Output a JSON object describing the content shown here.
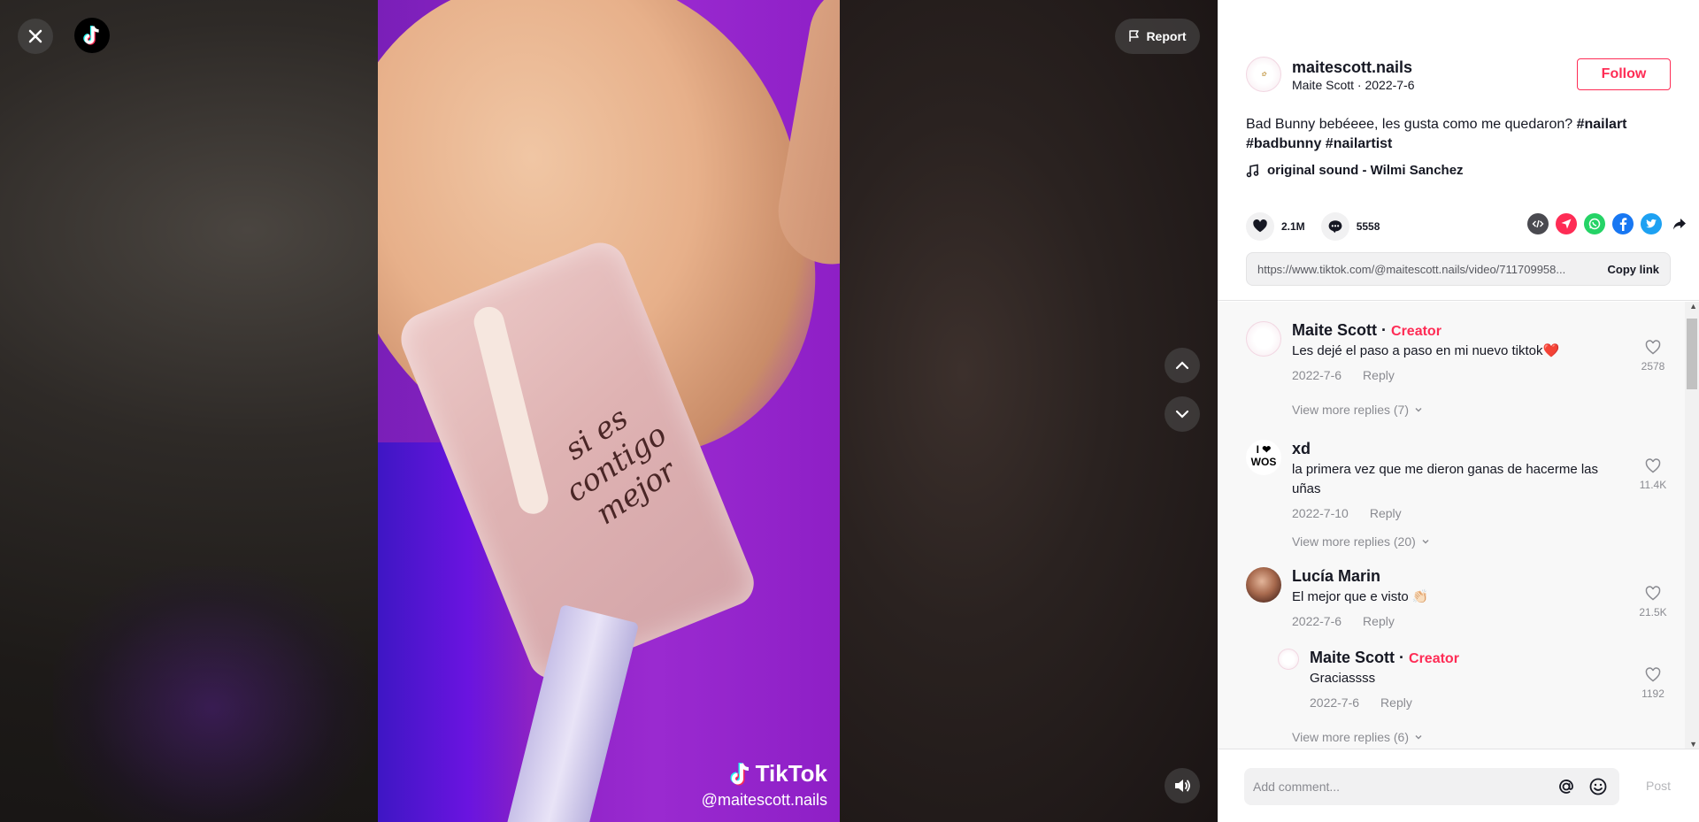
{
  "video": {
    "nail_text": "si es contigo mejor",
    "watermark_logo": "TikTok",
    "watermark_handle": "@maitescott.nails"
  },
  "overlay": {
    "report_label": "Report",
    "icons": [
      "close-icon",
      "tiktok-logo-icon",
      "flag-icon",
      "chevron-up-icon",
      "chevron-down-icon",
      "volume-icon"
    ]
  },
  "author": {
    "username": "maitescott.nails",
    "subtitle": "Maite Scott · 2022-7-6",
    "follow_label": "Follow"
  },
  "post": {
    "description": "Bad Bunny bebéeee, les gusta como me quedaron? ",
    "tags": [
      "#nailart",
      "#badbunny",
      "#nailartist"
    ],
    "music": "original sound - Wilmi Sanchez",
    "likes": "2.1M",
    "comments_count": "5558",
    "link": "https://www.tiktok.com/@maitescott.nails/video/711709958...",
    "copy_label": "Copy link",
    "share_colors": {
      "embed": "#4a4a50",
      "send": "#fe2c55",
      "whatsapp": "#25d366",
      "facebook": "#1877f2",
      "twitter": "#1da1f2"
    }
  },
  "comments": [
    {
      "name": "Maite Scott",
      "creator_label": "Creator",
      "text": "Les dejé el paso a paso en mi nuevo tiktok❤️",
      "date": "2022-7-6",
      "reply_label": "Reply",
      "likes": "2578",
      "more": "View more replies (7)"
    },
    {
      "name": "xd",
      "text": "la primera vez que me dieron ganas de hacerme las uñas",
      "date": "2022-7-10",
      "reply_label": "Reply",
      "likes": "11.4K",
      "more": "View more replies (20)",
      "avatar_text": "I ❤ WOS"
    },
    {
      "name": "Lucía Marin",
      "text": "El mejor que e visto 👏🏻",
      "date": "2022-7-6",
      "reply_label": "Reply",
      "likes": "21.5K"
    },
    {
      "name": "Maite Scott",
      "creator_label": "Creator",
      "text": "Graciassss",
      "date": "2022-7-6",
      "reply_label": "Reply",
      "likes": "1192",
      "more": "View more replies (6)"
    }
  ],
  "footer": {
    "placeholder": "Add comment...",
    "post_label": "Post"
  }
}
